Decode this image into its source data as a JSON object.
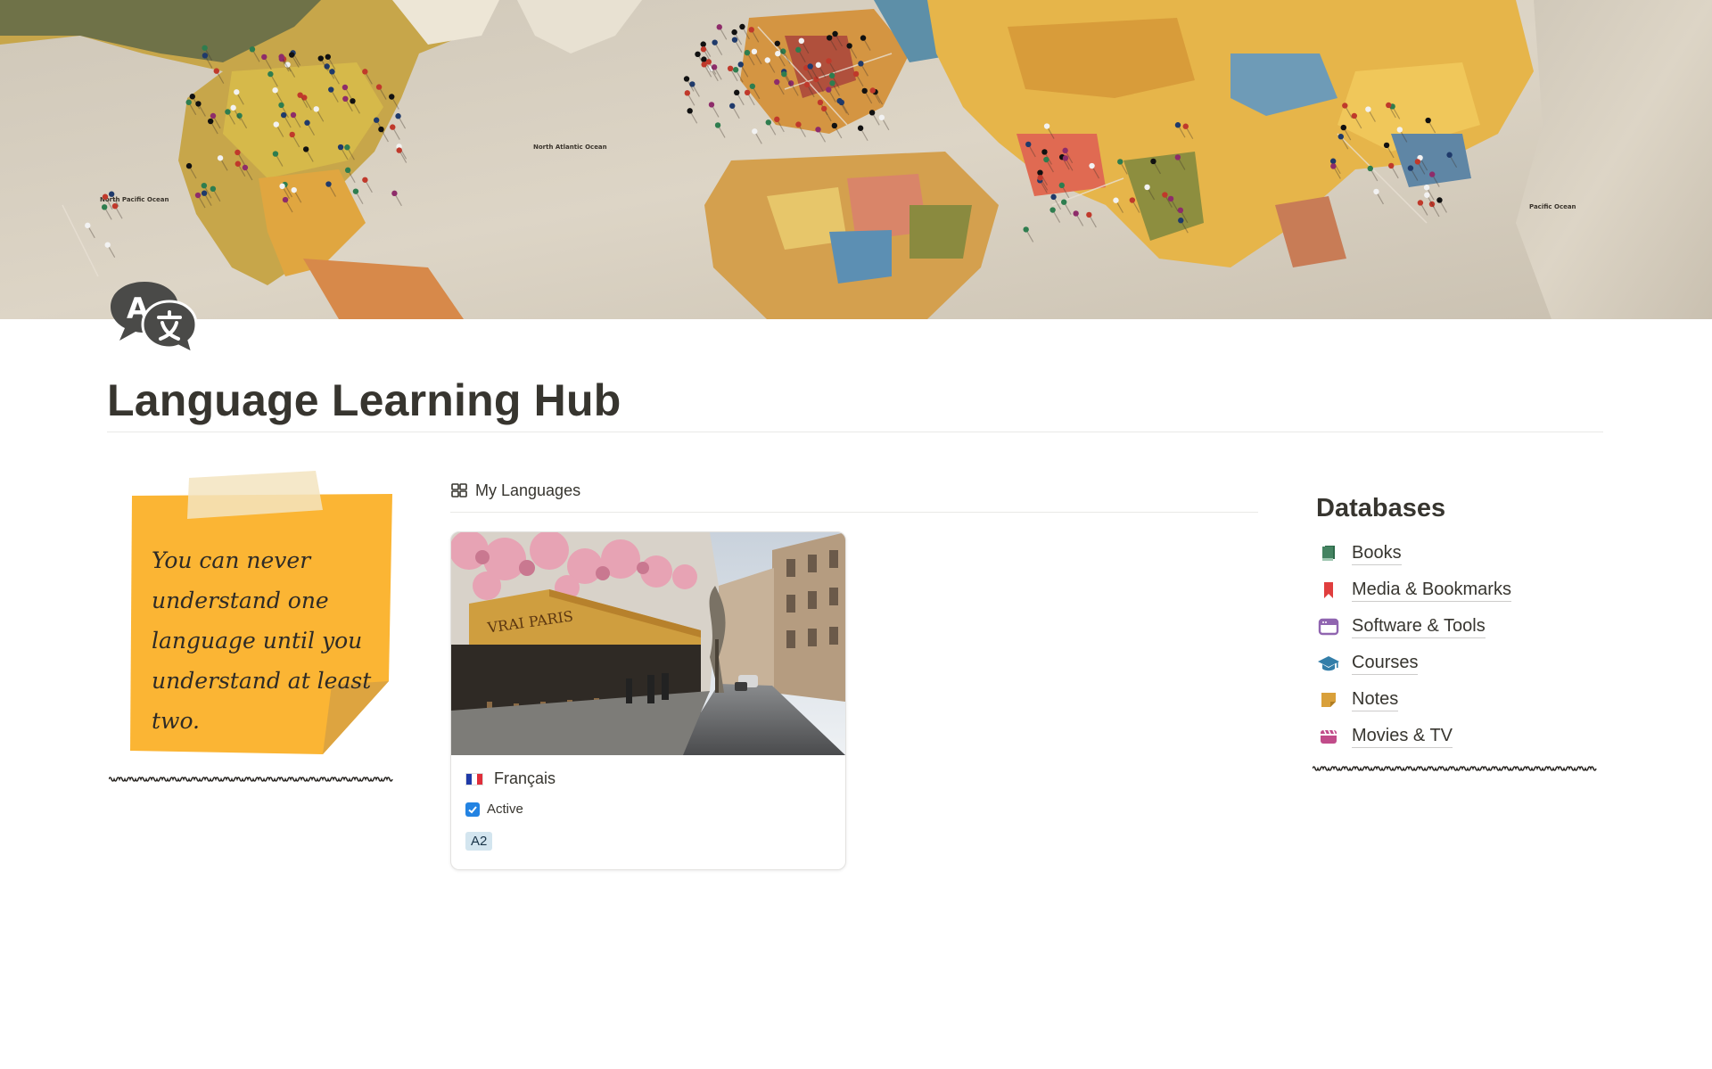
{
  "page": {
    "title": "Language Learning Hub",
    "icon": "translate-speech-bubbles-icon",
    "cover": "vintage-world-map-with-pins",
    "map_labels": [
      "North Pacific Ocean",
      "North Atlantic Ocean",
      "Pacific Ocean"
    ]
  },
  "note": {
    "quote": "You can never understand one language until you understand at least two.",
    "color": "#fbb534"
  },
  "gallery": {
    "view_icon": "gallery-grid-icon",
    "view_name": "My Languages",
    "cards": [
      {
        "cover": "paris-street-cafe-photo",
        "cover_sign": "VRAI PARIS",
        "flag": "french-flag-icon",
        "name": "Français",
        "active_label": "Active",
        "active": true,
        "level": "A2"
      }
    ]
  },
  "databases": {
    "heading": "Databases",
    "items": [
      {
        "label": "Books",
        "icon": "book-icon",
        "color": "#448361"
      },
      {
        "label": "Media & Bookmarks",
        "icon": "bookmark-icon",
        "color": "#e03e3e"
      },
      {
        "label": "Software & Tools",
        "icon": "browser-window-icon",
        "color": "#9065b0"
      },
      {
        "label": "Courses",
        "icon": "graduation-cap-icon",
        "color": "#337ea9"
      },
      {
        "label": "Notes",
        "icon": "sticky-note-icon",
        "color": "#d9730d"
      },
      {
        "label": "Movies & TV",
        "icon": "clapperboard-icon",
        "color": "#c14c8a"
      }
    ]
  }
}
